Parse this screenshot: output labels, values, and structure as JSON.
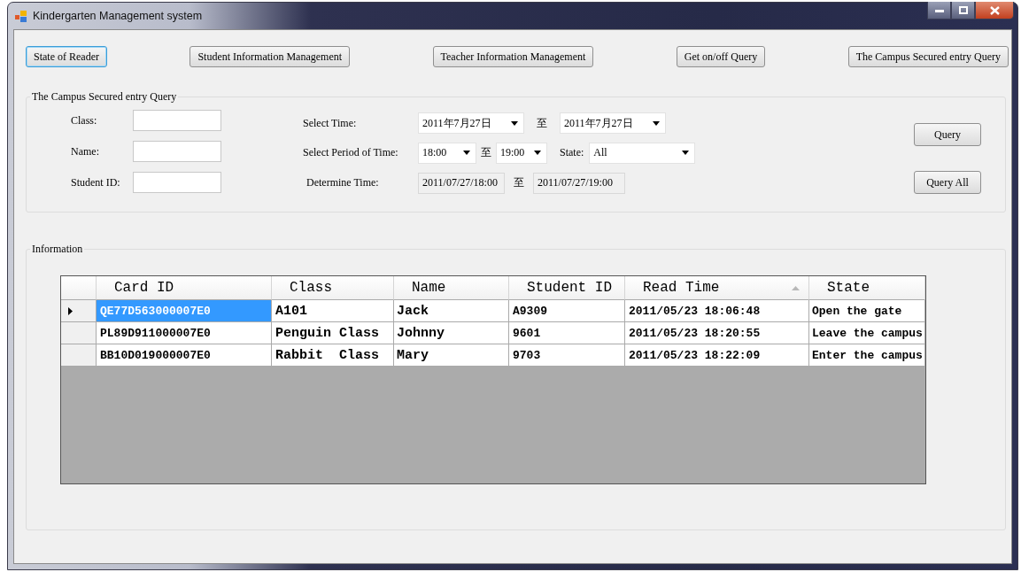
{
  "window": {
    "title": "Kindergarten Management system"
  },
  "nav_buttons": [
    {
      "label": "State of Reader",
      "focused": true
    },
    {
      "label": "Student Information Management",
      "focused": false
    },
    {
      "label": "Teacher Information Management",
      "focused": false
    },
    {
      "label": "Get on/off Query",
      "focused": false
    },
    {
      "label": "The Campus Secured entry Query",
      "focused": false
    }
  ],
  "query_group": {
    "title": "The Campus Secured entry Query",
    "text_fields": [
      {
        "label": "Class:"
      },
      {
        "label": "Name:"
      },
      {
        "label": "Student ID:"
      }
    ],
    "select_time": {
      "label": "Select Time:",
      "from": "2011年7月27日",
      "separator": "至",
      "to": "2011年7月27日"
    },
    "select_period": {
      "label": "Select Period of Time:",
      "from": "18:00",
      "separator": "至",
      "to": "19:00",
      "state_label": "State:",
      "state_value": "All"
    },
    "determine_time": {
      "label": "Determine Time:",
      "from": "2011/07/27/18:00",
      "separator": "至",
      "to": "2011/07/27/19:00"
    },
    "buttons": [
      "Query",
      "Query All"
    ]
  },
  "information": {
    "title": "Information",
    "columns": [
      {
        "label": "Card ID",
        "sorted": false
      },
      {
        "label": "Class",
        "sorted": false
      },
      {
        "label": "Name",
        "sorted": false
      },
      {
        "label": "Student ID",
        "sorted": false
      },
      {
        "label": "Read Time",
        "sorted": true
      },
      {
        "label": "State",
        "sorted": false
      }
    ],
    "rows": [
      {
        "current": true,
        "cells": [
          {
            "text": "QE77D563000007E0",
            "selected": true
          },
          {
            "text": "A101",
            "selected": false
          },
          {
            "text": "Jack",
            "selected": false
          },
          {
            "text": "A9309",
            "selected": false
          },
          {
            "text": "2011/05/23 18:06:48",
            "selected": false
          },
          {
            "text": "Open the gate",
            "selected": false
          }
        ]
      },
      {
        "current": false,
        "cells": [
          {
            "text": "PL89D911000007E0",
            "selected": false
          },
          {
            "text": "Penguin Class",
            "selected": false
          },
          {
            "text": "Johnny",
            "selected": false
          },
          {
            "text": "9601",
            "selected": false
          },
          {
            "text": "2011/05/23 18:20:55",
            "selected": false
          },
          {
            "text": "Leave the campus",
            "selected": false
          }
        ]
      },
      {
        "current": false,
        "cells": [
          {
            "text": "BB10D019000007E0",
            "selected": false
          },
          {
            "text": "Rabbit  Class",
            "selected": false
          },
          {
            "text": "Mary",
            "selected": false
          },
          {
            "text": "9703",
            "selected": false
          },
          {
            "text": "2011/05/23 18:22:09",
            "selected": false
          },
          {
            "text": "Enter the campus",
            "selected": false
          }
        ]
      }
    ]
  }
}
